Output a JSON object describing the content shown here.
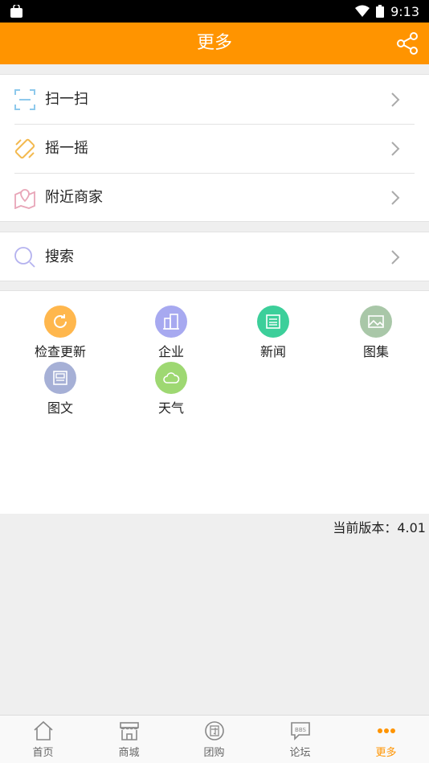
{
  "status_bar": {
    "time": "9:13"
  },
  "header": {
    "title": "更多"
  },
  "menu_group_1": [
    {
      "label": "扫一扫",
      "icon": "scan-icon"
    },
    {
      "label": "摇一摇",
      "icon": "shake-icon"
    },
    {
      "label": "附近商家",
      "icon": "map-icon"
    }
  ],
  "menu_group_2": [
    {
      "label": "搜索",
      "icon": "search-icon"
    }
  ],
  "grid": [
    {
      "label": "检查更新",
      "icon": "refresh-icon",
      "color": "#ffb74d"
    },
    {
      "label": "企业",
      "icon": "building-icon",
      "color": "#a7a9f0"
    },
    {
      "label": "新闻",
      "icon": "news-icon",
      "color": "#3ccf9a"
    },
    {
      "label": "图集",
      "icon": "image-icon",
      "color": "#a9c7a8"
    },
    {
      "label": "图文",
      "icon": "article-icon",
      "color": "#a6b0d6"
    },
    {
      "label": "天气",
      "icon": "cloud-icon",
      "color": "#9ed872"
    }
  ],
  "version_text": "当前版本：4.01",
  "tabs": [
    {
      "label": "首页",
      "icon": "home-icon"
    },
    {
      "label": "商城",
      "icon": "store-icon"
    },
    {
      "label": "团购",
      "icon": "group-buy-icon"
    },
    {
      "label": "论坛",
      "icon": "bbs-icon"
    },
    {
      "label": "更多",
      "icon": "more-dots-icon",
      "active": true
    }
  ],
  "colors": {
    "accent": "#ff9400"
  }
}
